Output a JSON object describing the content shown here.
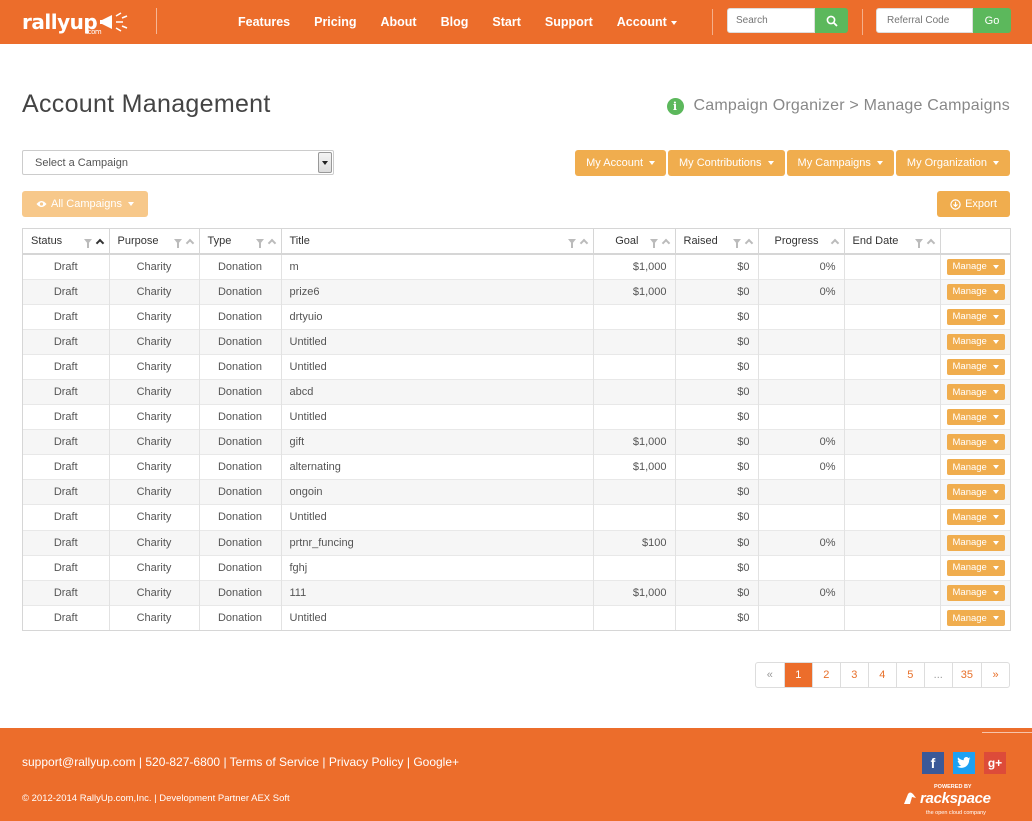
{
  "brand": {
    "name": "rallyup",
    "sub": ".com"
  },
  "nav": {
    "items": [
      "Features",
      "Pricing",
      "About",
      "Blog",
      "Start",
      "Support"
    ],
    "account": "Account"
  },
  "search": {
    "placeholder": "Search"
  },
  "referral": {
    "placeholder": "Referral Code",
    "go_label": "Go"
  },
  "page": {
    "title": "Account Management",
    "breadcrumb": "Campaign Organizer > Manage Campaigns"
  },
  "controls": {
    "select_placeholder": "Select a Campaign",
    "menus": [
      "My Account",
      "My Contributions",
      "My Campaigns",
      "My Organization"
    ],
    "all_campaigns": "All Campaigns",
    "export": "Export"
  },
  "table": {
    "columns": [
      "Status",
      "Purpose",
      "Type",
      "Title",
      "Goal",
      "Raised",
      "Progress",
      "End Date"
    ],
    "manage_label": "Manage",
    "rows": [
      {
        "status": "Draft",
        "purpose": "Charity",
        "type": "Donation",
        "title": "m",
        "goal": "$1,000",
        "raised": "$0",
        "progress": "0%"
      },
      {
        "status": "Draft",
        "purpose": "Charity",
        "type": "Donation",
        "title": "prize6",
        "goal": "$1,000",
        "raised": "$0",
        "progress": "0%"
      },
      {
        "status": "Draft",
        "purpose": "Charity",
        "type": "Donation",
        "title": "drtyuio",
        "goal": "",
        "raised": "$0",
        "progress": ""
      },
      {
        "status": "Draft",
        "purpose": "Charity",
        "type": "Donation",
        "title": "Untitled",
        "goal": "",
        "raised": "$0",
        "progress": ""
      },
      {
        "status": "Draft",
        "purpose": "Charity",
        "type": "Donation",
        "title": "Untitled",
        "goal": "",
        "raised": "$0",
        "progress": ""
      },
      {
        "status": "Draft",
        "purpose": "Charity",
        "type": "Donation",
        "title": "abcd",
        "goal": "",
        "raised": "$0",
        "progress": ""
      },
      {
        "status": "Draft",
        "purpose": "Charity",
        "type": "Donation",
        "title": "Untitled",
        "goal": "",
        "raised": "$0",
        "progress": ""
      },
      {
        "status": "Draft",
        "purpose": "Charity",
        "type": "Donation",
        "title": "gift",
        "goal": "$1,000",
        "raised": "$0",
        "progress": "0%"
      },
      {
        "status": "Draft",
        "purpose": "Charity",
        "type": "Donation",
        "title": "alternating",
        "goal": "$1,000",
        "raised": "$0",
        "progress": "0%"
      },
      {
        "status": "Draft",
        "purpose": "Charity",
        "type": "Donation",
        "title": "ongoin",
        "goal": "",
        "raised": "$0",
        "progress": ""
      },
      {
        "status": "Draft",
        "purpose": "Charity",
        "type": "Donation",
        "title": "Untitled",
        "goal": "",
        "raised": "$0",
        "progress": ""
      },
      {
        "status": "Draft",
        "purpose": "Charity",
        "type": "Donation",
        "title": "prtnr_funcing",
        "goal": "$100",
        "raised": "$0",
        "progress": "0%"
      },
      {
        "status": "Draft",
        "purpose": "Charity",
        "type": "Donation",
        "title": "fghj",
        "goal": "",
        "raised": "$0",
        "progress": ""
      },
      {
        "status": "Draft",
        "purpose": "Charity",
        "type": "Donation",
        "title": "111",
        "goal": "$1,000",
        "raised": "$0",
        "progress": "0%"
      },
      {
        "status": "Draft",
        "purpose": "Charity",
        "type": "Donation",
        "title": "Untitled",
        "goal": "",
        "raised": "$0",
        "progress": ""
      }
    ]
  },
  "pagination": {
    "prev": "«",
    "pages": [
      "1",
      "2",
      "3",
      "4",
      "5",
      "...",
      "35"
    ],
    "next": "»",
    "active": "1"
  },
  "footer": {
    "email": "support@rallyup.com",
    "phone": "520-827-6800",
    "terms": "Terms of Service",
    "privacy": "Privacy Policy",
    "google": "Google+",
    "copyright": "© 2012-2014 RallyUp.com,Inc. | Development Partner AEX Soft",
    "social": [
      "facebook-icon",
      "twitter-icon",
      "google-plus-icon"
    ],
    "rackspace": {
      "powered": "POWERED BY",
      "name": "rackspace",
      "tag": "the open cloud company"
    }
  },
  "colors": {
    "brand_orange": "#ec6d2b",
    "button_orange": "#f0ad4e",
    "green": "#5cb85c",
    "link_orange": "#e8702a"
  }
}
